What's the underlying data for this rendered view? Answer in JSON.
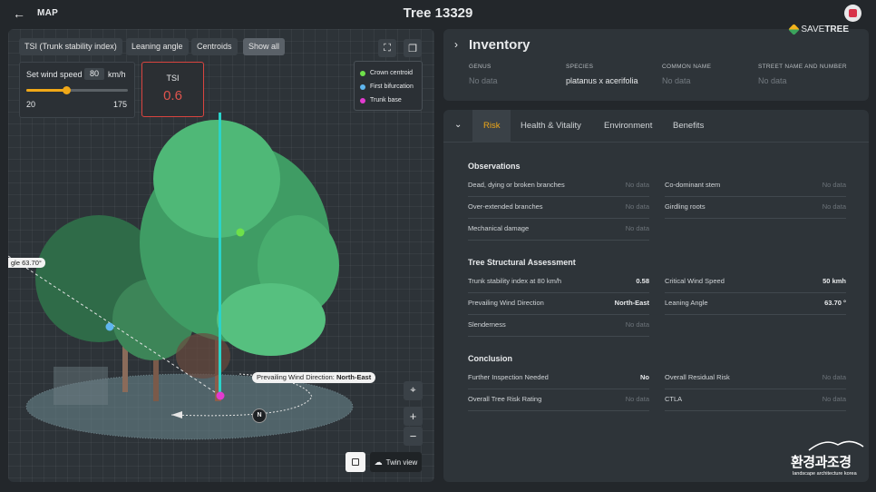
{
  "header": {
    "back_label": "MAP",
    "title": "Tree 13329"
  },
  "viewer": {
    "chips": [
      "TSI (Trunk stability index)",
      "Leaning angle",
      "Centroids",
      "Show all"
    ],
    "active_chip": "Show all",
    "wind": {
      "label": "Set wind speed",
      "value": "80",
      "unit": "km/h",
      "min": "20",
      "max": "175",
      "fraction": 0.39
    },
    "tsi": {
      "label": "TSI",
      "value": "0.6"
    },
    "legend": [
      {
        "label": "Crown centroid",
        "color": "#6fe04a"
      },
      {
        "label": "First bifurcation",
        "color": "#5fb6ef"
      },
      {
        "label": "Trunk base",
        "color": "#e33bd0"
      }
    ],
    "angle_tag": "gle 63.70°",
    "wind_tag_prefix": "Prevailing Wind Direction: ",
    "wind_tag_value": "North-East",
    "north": "N",
    "zoom_in": "+",
    "zoom_out": "−",
    "twin_view": "Twin view"
  },
  "inventory": {
    "title": "Inventory",
    "brand_prefix": "SAVE",
    "brand_suffix": "TREE",
    "fields": [
      {
        "key": "GENUS",
        "value": "No data",
        "empty": true
      },
      {
        "key": "SPECIES",
        "value": "platanus x acerifolia",
        "empty": false
      },
      {
        "key": "COMMON NAME",
        "value": "No data",
        "empty": true
      },
      {
        "key": "STREET NAME AND NUMBER",
        "value": "No data",
        "empty": true
      }
    ]
  },
  "risk": {
    "tabs": [
      "Risk",
      "Health & Vitality",
      "Environment",
      "Benefits"
    ],
    "active_tab": "Risk",
    "sections": [
      {
        "title": "Observations",
        "rows": [
          [
            {
              "k": "Dead, dying or broken branches",
              "v": "No data",
              "empty": true
            },
            {
              "k": "Co-dominant stem",
              "v": "No data",
              "empty": true
            }
          ],
          [
            {
              "k": "Over-extended branches",
              "v": "No data",
              "empty": true
            },
            {
              "k": "Girdling roots",
              "v": "No data",
              "empty": true
            }
          ],
          [
            {
              "k": "Mechanical damage",
              "v": "No data",
              "empty": true
            }
          ]
        ]
      },
      {
        "title": "Tree Structural Assessment",
        "rows": [
          [
            {
              "k": "Trunk stability index at 80 km/h",
              "v": "0.58",
              "empty": false
            },
            {
              "k": "Critical Wind Speed",
              "v": "50 kmh",
              "empty": false
            }
          ],
          [
            {
              "k": "Prevailing Wind Direction",
              "v": "North-East",
              "empty": false
            },
            {
              "k": "Leaning Angle",
              "v": "63.70 °",
              "empty": false
            }
          ],
          [
            {
              "k": "Slenderness",
              "v": "No data",
              "empty": true
            }
          ]
        ]
      },
      {
        "title": "Conclusion",
        "rows": [
          [
            {
              "k": "Further Inspection Needed",
              "v": "No",
              "empty": false
            },
            {
              "k": "Overall Residual Risk",
              "v": "No data",
              "empty": true
            }
          ],
          [
            {
              "k": "Overall Tree Risk Rating",
              "v": "No data",
              "empty": true
            },
            {
              "k": "CTLA",
              "v": "No data",
              "empty": true
            }
          ]
        ]
      }
    ]
  },
  "footer": {
    "logo_main": "환경과조경",
    "logo_sub": "landscape architecture korea"
  }
}
